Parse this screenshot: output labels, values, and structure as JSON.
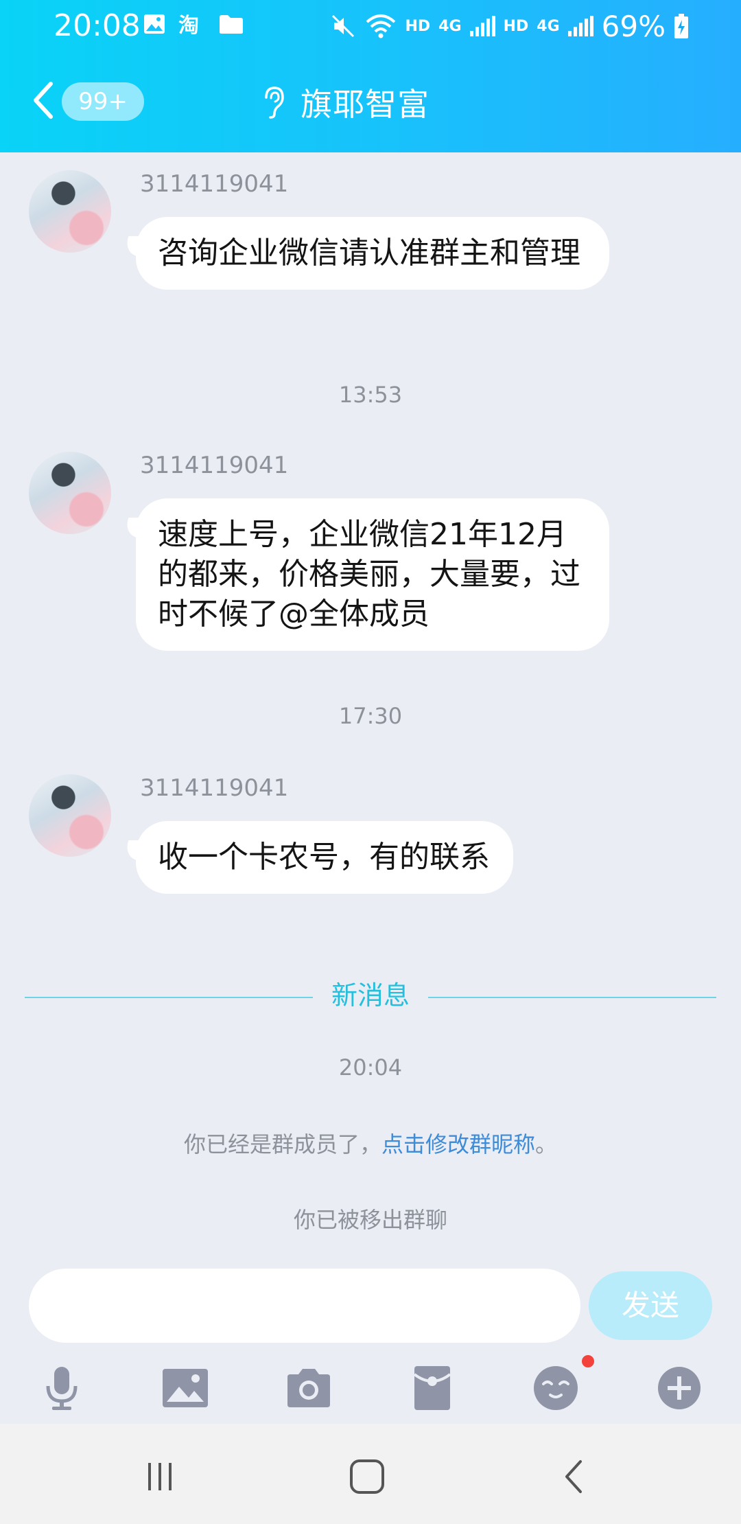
{
  "status_bar": {
    "time": "20:08",
    "net1": "HD",
    "net1_type": "4G",
    "net2": "HD",
    "net2_type": "4G",
    "battery": "69%",
    "left_icons": [
      "image-icon",
      "taobao-icon",
      "folder-icon"
    ],
    "right_icons": [
      "mute-icon",
      "wifi-icon",
      "signal-icon",
      "signal-icon",
      "battery-charging-icon"
    ]
  },
  "header": {
    "unread_count": "99+",
    "title": "旗耶智富",
    "title_icon": "ear-icon"
  },
  "messages": [
    {
      "sender": "3114119041",
      "text": "咨询企业微信请认准群主和管理"
    },
    {
      "sender": "3114119041",
      "text": "速度上号，企业微信21年12月的都来，价格美丽，大量要，过时不候了@全体成员"
    },
    {
      "sender": "3114119041",
      "text": "收一个卡农号，有的联系"
    }
  ],
  "timestamps": [
    "13:53",
    "17:30",
    "20:04"
  ],
  "new_messages_label": "新消息",
  "system": {
    "member_prefix": "你已经是群成员了，",
    "member_link": "点击修改群昵称",
    "member_suffix": "。",
    "removed": "你已被移出群聊"
  },
  "input": {
    "value": "",
    "send_label": "发送"
  },
  "colors": {
    "header_start": "#09d3f7",
    "header_end": "#26aefe",
    "new_msg_accent": "#23bfdc",
    "link": "#3e8bd8",
    "send_button": "#b8ecfb",
    "badge_dot": "#f3413b"
  }
}
